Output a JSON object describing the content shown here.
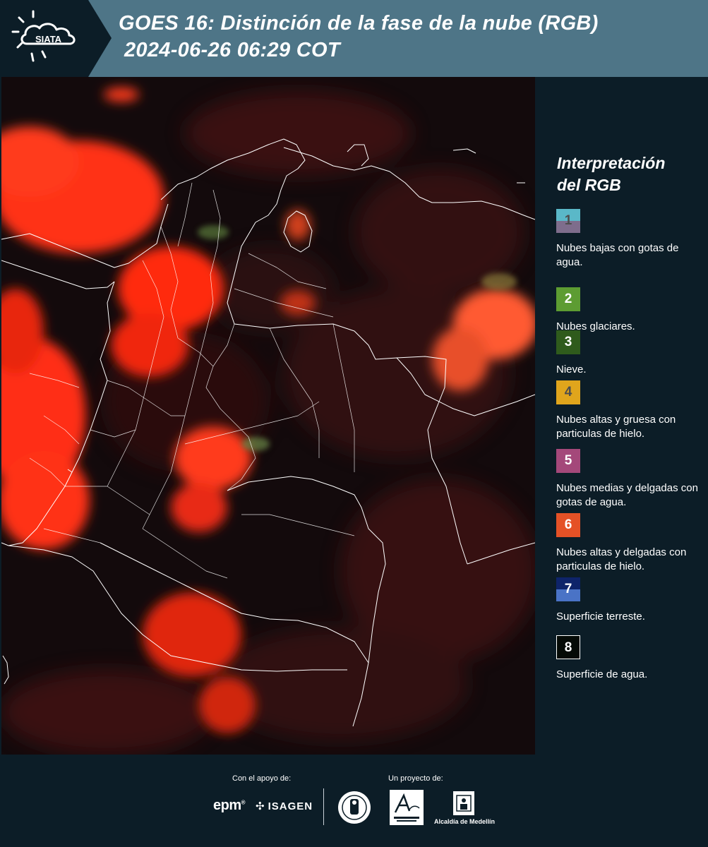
{
  "header": {
    "logo_text": "SIATA",
    "title_line1": "GOES 16: Distinción de la fase de la nube (RGB)",
    "title_line2": "2024-06-26 06:29 COT"
  },
  "legend": {
    "title_line1": "Interpretación",
    "title_line2": "del RGB",
    "items": [
      {
        "number": "1",
        "label": "Nubes bajas con gotas de agua.",
        "color_top": "#5ab8c8",
        "color_bottom": "#7e6d8c",
        "text_color": "#4d4d4d"
      },
      {
        "number": "2",
        "label": "Nubes glaciares.",
        "color_top": "#5d9c32",
        "color_bottom": "#5d9c32",
        "text_color": "#ffffff"
      },
      {
        "number": "3",
        "label": "Nieve.",
        "color_top": "#2f5b1c",
        "color_bottom": "#2f5b1c",
        "text_color": "#ffffff"
      },
      {
        "number": "4",
        "label": "Nubes altas y gruesa con particulas de hielo.",
        "color_top": "#e0a51c",
        "color_bottom": "#e0a51c",
        "text_color": "#4d4d4d"
      },
      {
        "number": "5",
        "label": "Nubes medias y delgadas con gotas de agua.",
        "color_top": "#a4487a",
        "color_bottom": "#a4487a",
        "text_color": "#ffffff"
      },
      {
        "number": "6",
        "label": "Nubes altas y delgadas con particulas de hielo.",
        "color_top": "#e55126",
        "color_bottom": "#e55126",
        "text_color": "#ffffff"
      },
      {
        "number": "7",
        "label": "Superficie terreste.",
        "color_top": "#0e246a",
        "color_bottom": "#4a73c6",
        "text_color": "#ffffff"
      },
      {
        "number": "8",
        "label": "Superficie de agua.",
        "color_top": "#050a06",
        "color_bottom": "#050a06",
        "text_color": "#ffffff"
      }
    ]
  },
  "footer": {
    "support_label": "Con el apoyo de:",
    "project_label": "Un proyecto de:",
    "sponsor_1": "epm",
    "sponsor_2": "ISAGEN",
    "partner_1": "Área Metropolitana",
    "partner_2": "Alcaldía de Medellín"
  },
  "colors": {
    "header_bg": "#4e7587",
    "panel_bg": "#0c1d27",
    "cloud_red": "#ff2a10",
    "border_white": "#ffffff"
  }
}
